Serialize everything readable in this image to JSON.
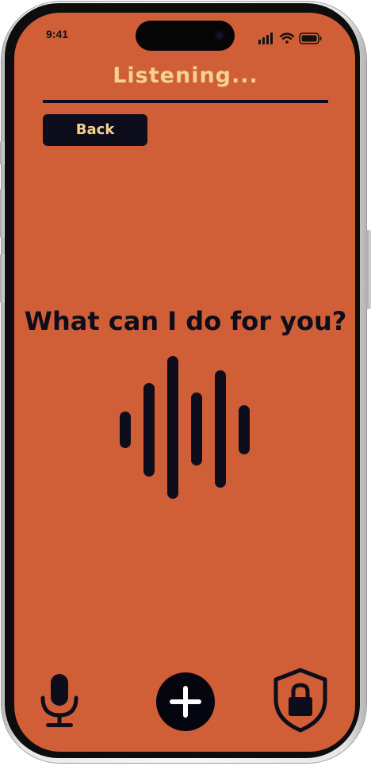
{
  "status_bar": {
    "time": "9:41",
    "icons": [
      "signal-icon",
      "wifi-icon",
      "battery-icon"
    ]
  },
  "header": {
    "title": "Listening..."
  },
  "back_button": {
    "label": "Back"
  },
  "main": {
    "prompt": "What can I do for you?",
    "waveform_icon": "sound-waveform-icon"
  },
  "bottom_bar": {
    "left_icon": "microphone-icon",
    "center_icon": "add-icon",
    "right_icon": "shield-lock-icon"
  },
  "colors": {
    "background": "#d05e37",
    "accent_text": "#f5d28e",
    "dark": "#0d0d1c"
  }
}
